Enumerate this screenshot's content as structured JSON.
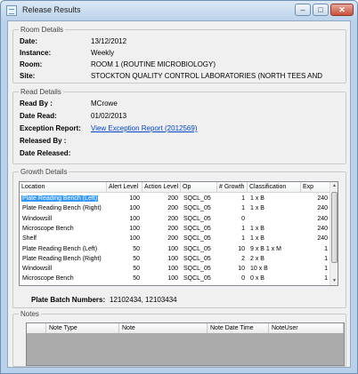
{
  "window": {
    "title": "Release Results",
    "min_glyph": "–",
    "max_glyph": "□",
    "close_glyph": "✕"
  },
  "room_details": {
    "title": "Room Details",
    "date_label": "Date:",
    "date": "13/12/2012",
    "instance_label": "Instance:",
    "instance": "Weekly",
    "room_label": "Room:",
    "room": "ROOM 1 (ROUTINE MICROBIOLOGY)",
    "site_label": "Site:",
    "site": "STOCKTON QUALITY CONTROL LABORATORIES (NORTH TEES AND"
  },
  "read_details": {
    "title": "Read Details",
    "read_by_label": "Read By :",
    "read_by": "MCrowe",
    "date_read_label": "Date Read:",
    "date_read": "01/02/2013",
    "exception_label": "Exception Report:",
    "exception_link": "View Exception Report (2012569)",
    "released_by_label": "Released By :",
    "date_released_label": "Date Released:"
  },
  "growth_details": {
    "title": "Growth Details",
    "columns": [
      "Location",
      "Alert Level",
      "Action Level",
      "Op",
      "# Growth",
      "Classification",
      "Exp"
    ],
    "rows": [
      [
        "Plate Reading Bench (Left)",
        "100",
        "200",
        "SQCL_05",
        "1",
        "1 x B",
        "240"
      ],
      [
        "Plate Reading Bench (Right)",
        "100",
        "200",
        "SQCL_05",
        "1",
        "1 x B",
        "240"
      ],
      [
        "Windowsill",
        "100",
        "200",
        "SQCL_05",
        "0",
        "",
        "240"
      ],
      [
        "Microscope Bench",
        "100",
        "200",
        "SQCL_05",
        "1",
        "1 x B",
        "240"
      ],
      [
        "Shelf",
        "100",
        "200",
        "SQCL_05",
        "1",
        "1 x B",
        "240"
      ],
      [
        "Plate Reading Bench (Left)",
        "50",
        "100",
        "SQCL_05",
        "10",
        "9 x B 1 x M",
        "1"
      ],
      [
        "Plate Reading Bench (Right)",
        "50",
        "100",
        "SQCL_05",
        "2",
        "2 x B",
        "1"
      ],
      [
        "Windowsill",
        "50",
        "100",
        "SQCL_05",
        "10",
        "10 x B",
        "1"
      ],
      [
        "Microscope Bench",
        "50",
        "100",
        "SQCL_05",
        "0",
        "0 x B",
        "1"
      ]
    ],
    "batch_label": "Plate Batch Numbers:",
    "batch_value": "12102434, 12103434"
  },
  "notes": {
    "title": "Notes",
    "columns": [
      "Note Type",
      "Note",
      "Note Date Time",
      "NoteUser"
    ]
  }
}
